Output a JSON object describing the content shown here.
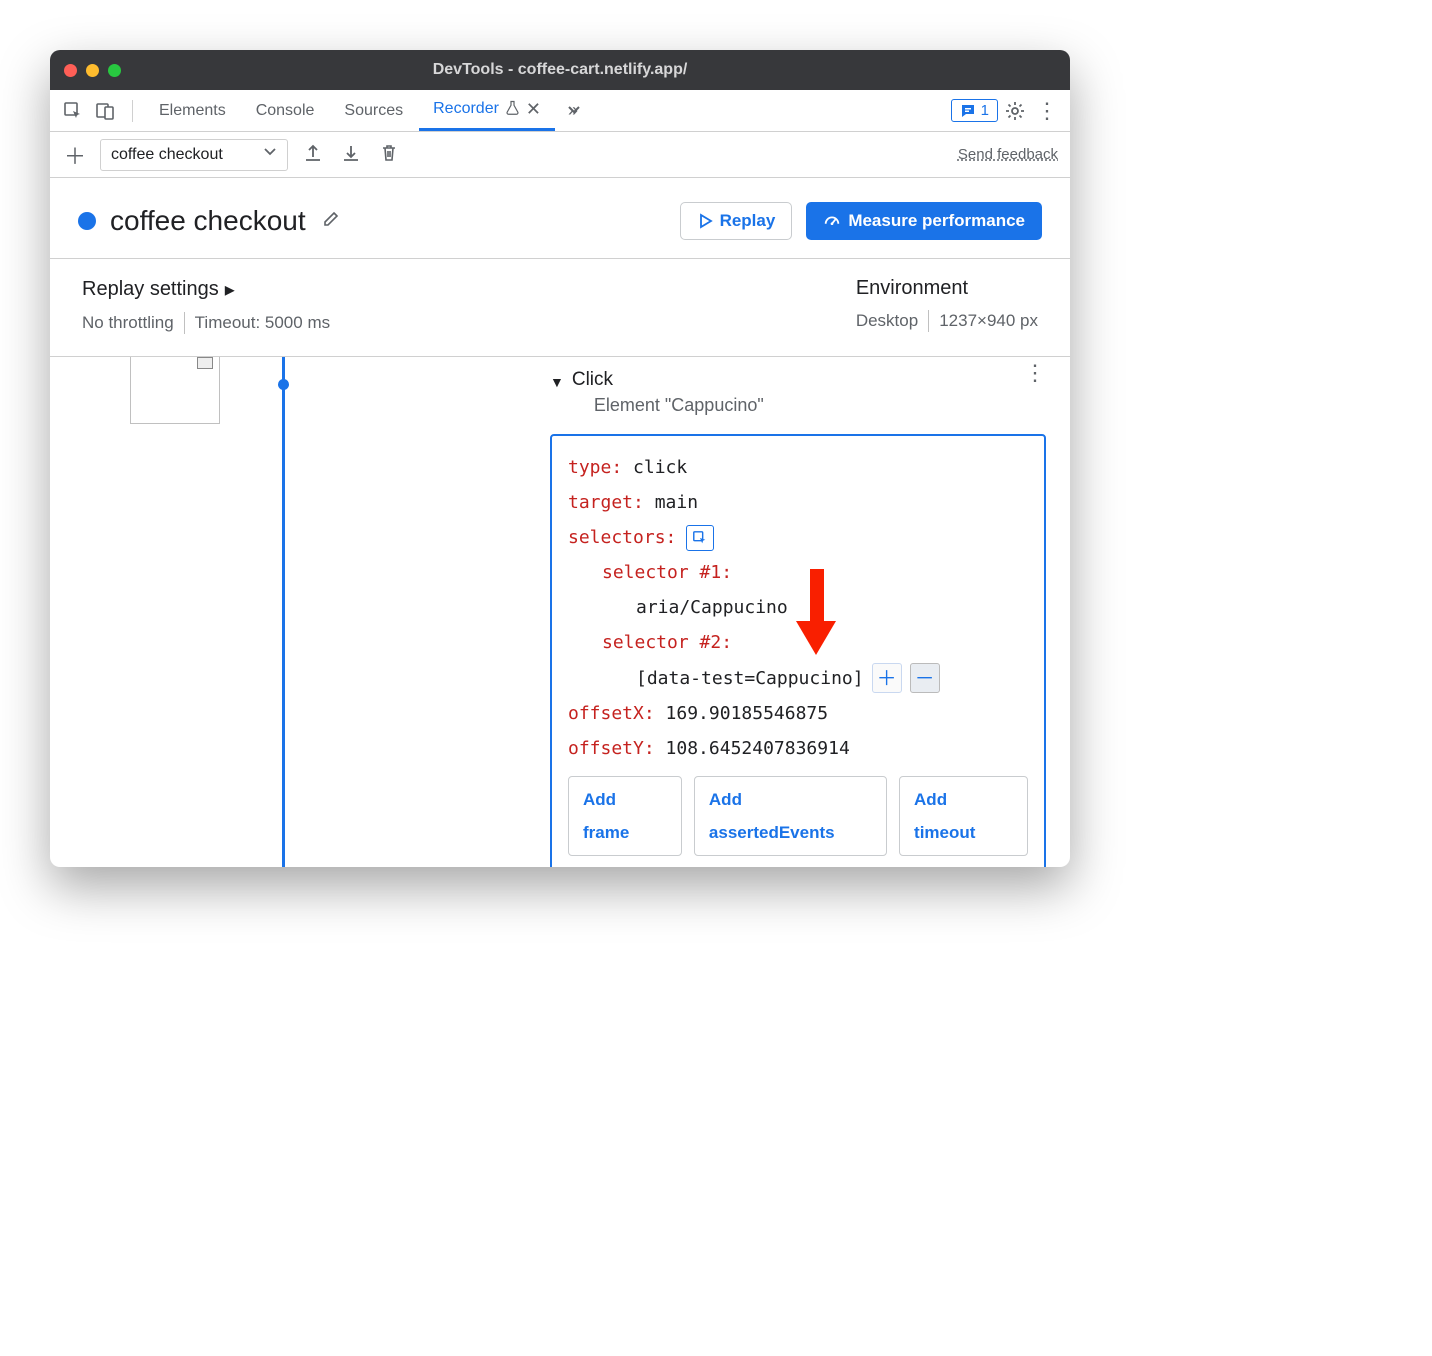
{
  "window": {
    "title": "DevTools - coffee-cart.netlify.app/"
  },
  "tabs": {
    "items": [
      "Elements",
      "Console",
      "Sources",
      "Recorder"
    ],
    "active": "Recorder",
    "issues_count": "1"
  },
  "toolbar": {
    "dropdown_value": "coffee checkout",
    "feedback": "Send feedback"
  },
  "recording": {
    "title": "coffee checkout",
    "replay_label": "Replay",
    "measure_label": "Measure performance"
  },
  "settings": {
    "replay_heading": "Replay settings",
    "throttling": "No throttling",
    "timeout": "Timeout: 5000 ms",
    "env_heading": "Environment",
    "device": "Desktop",
    "viewport": "1237×940 px"
  },
  "step": {
    "title": "Click",
    "subtitle": "Element \"Cappucino\"",
    "props": {
      "type_label": "type",
      "type_value": "click",
      "target_label": "target",
      "target_value": "main",
      "selectors_label": "selectors",
      "sel1_label": "selector #1",
      "sel1_value": "aria/Cappucino",
      "sel2_label": "selector #2",
      "sel2_value": "[data-test=Cappucino]",
      "offsetX_label": "offsetX",
      "offsetX_value": "169.90185546875",
      "offsetY_label": "offsetY",
      "offsetY_value": "108.6452407836914"
    },
    "chips": {
      "add_frame": "Add frame",
      "add_asserted": "Add assertedEvents",
      "add_timeout": "Add timeout"
    }
  }
}
